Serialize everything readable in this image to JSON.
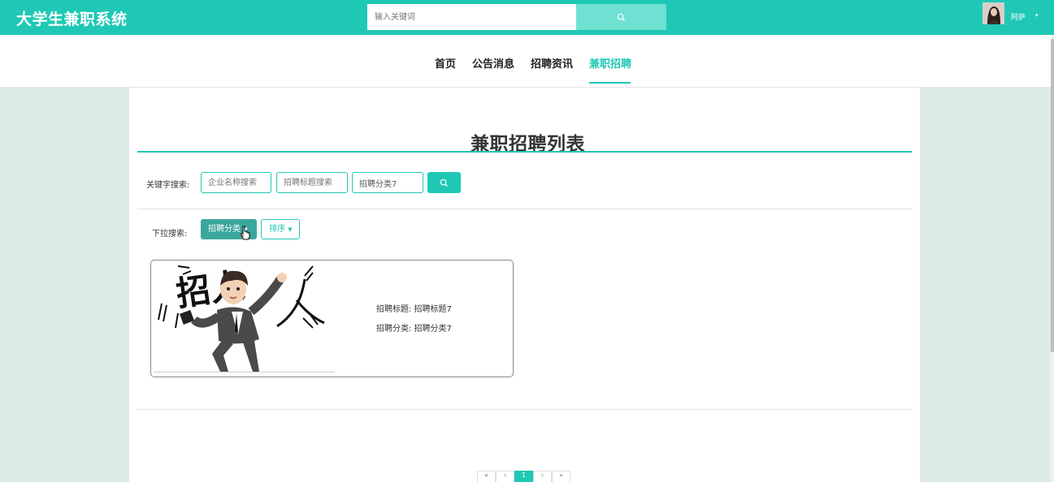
{
  "header": {
    "brand": "大学生兼职系统",
    "search_placeholder": "输入关键词",
    "search_icon": "search-icon",
    "username": "阿萨",
    "user_caret": "▾"
  },
  "nav": {
    "items": [
      {
        "label": "首页"
      },
      {
        "label": "公告消息"
      },
      {
        "label": "招聘资讯"
      },
      {
        "label": "兼职招聘",
        "active": true
      }
    ]
  },
  "page": {
    "title": "兼职招聘列表"
  },
  "filters": {
    "keyword_label": "关键字搜索:",
    "company_placeholder": "企业名称搜索",
    "title_placeholder": "招聘标题搜索",
    "category_value": "招聘分类7",
    "dropdown_label": "下拉搜索:",
    "category_dropdown": "招聘分类",
    "sort_dropdown": "排序"
  },
  "listings": [
    {
      "image_text": "招人",
      "title_line": "招聘标题: 招聘标题7",
      "category_line": "招聘分类: 招聘分类7"
    }
  ],
  "pagination": {
    "prev": "«",
    "prev2": "‹",
    "current": "1",
    "next": "›",
    "next2": "»"
  },
  "colors": {
    "accent": "#1fc8b5",
    "accent_dark": "#3aa69d",
    "page_bg": "#dcebe8"
  }
}
